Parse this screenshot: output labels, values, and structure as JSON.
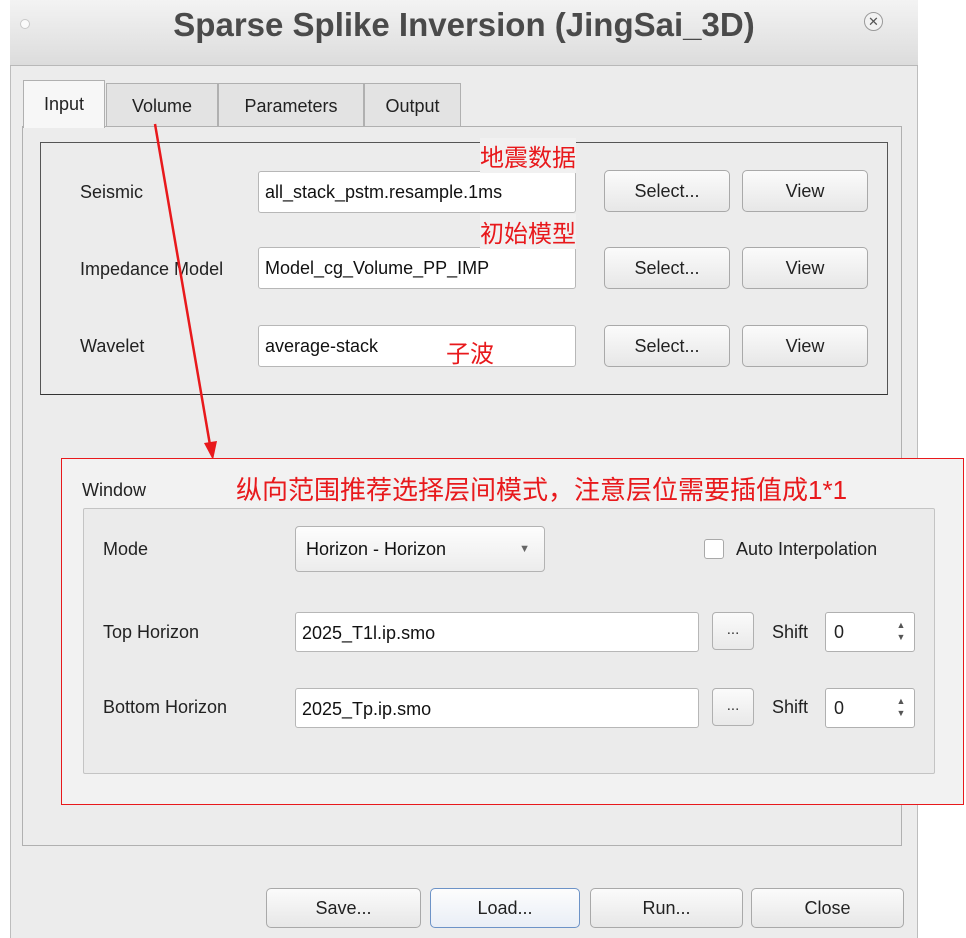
{
  "window": {
    "title": "Sparse Splike Inversion (JingSai_3D)"
  },
  "tabs": [
    "Input",
    "Volume",
    "Parameters",
    "Output"
  ],
  "input": {
    "rows": [
      {
        "label": "Seismic",
        "value": "all_stack_pstm.resample.1ms",
        "select_label": "Select...",
        "view_label": "View"
      },
      {
        "label": "Impedance Model",
        "value": "Model_cg_Volume_PP_IMP",
        "select_label": "Select...",
        "view_label": "View"
      },
      {
        "label": "Wavelet",
        "value": "average-stack",
        "select_label": "Select...",
        "view_label": "View"
      }
    ]
  },
  "window_group": {
    "title": "Window",
    "mode_label": "Mode",
    "mode_value": "Horizon - Horizon",
    "auto_interpolation_label": "Auto Interpolation",
    "auto_interpolation_checked": false,
    "top_horizon_label": "Top Horizon",
    "top_horizon_value": "2025_T1l.ip.smo",
    "bottom_horizon_label": "Bottom Horizon",
    "bottom_horizon_value": "2025_Tp.ip.smo",
    "browse_label": "...",
    "shift_label": "Shift",
    "top_shift_value": "0",
    "bottom_shift_value": "0"
  },
  "annotations": {
    "seismic_note": "地震数据",
    "model_note": "初始模型",
    "wavelet_note": "子波",
    "window_note": "纵向范围推荐选择层间模式，注意层位需要插值成1*1"
  },
  "footer": {
    "save": "Save...",
    "load": "Load...",
    "run": "Run...",
    "close": "Close"
  },
  "colors": {
    "annotation": "#e8191c",
    "background": "#ececec"
  }
}
